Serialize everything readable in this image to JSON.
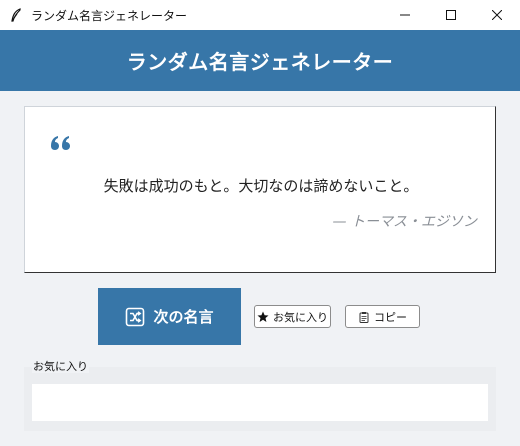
{
  "window": {
    "title": "ランダム名言ジェネレーター",
    "icons": {
      "app": "feather-icon",
      "minimize": "minimize-icon",
      "maximize": "maximize-icon",
      "close": "close-icon"
    }
  },
  "header": {
    "title": "ランダム名言ジェネレーター",
    "color": "#3776a8"
  },
  "quote": {
    "text": "失敗は成功のもと。大切なのは諦めないこと。",
    "author": "— トーマス・エジソン",
    "mark_icon": "quote-mark-icon",
    "mark_color": "#3776a8"
  },
  "buttons": {
    "next": {
      "label": "次の名言",
      "icon": "shuffle-icon"
    },
    "favorite": {
      "label": "お気に入り",
      "icon": "star-icon"
    },
    "copy": {
      "label": "コピー",
      "icon": "clipboard-icon"
    }
  },
  "favorites": {
    "label": "お気に入り",
    "items": []
  }
}
